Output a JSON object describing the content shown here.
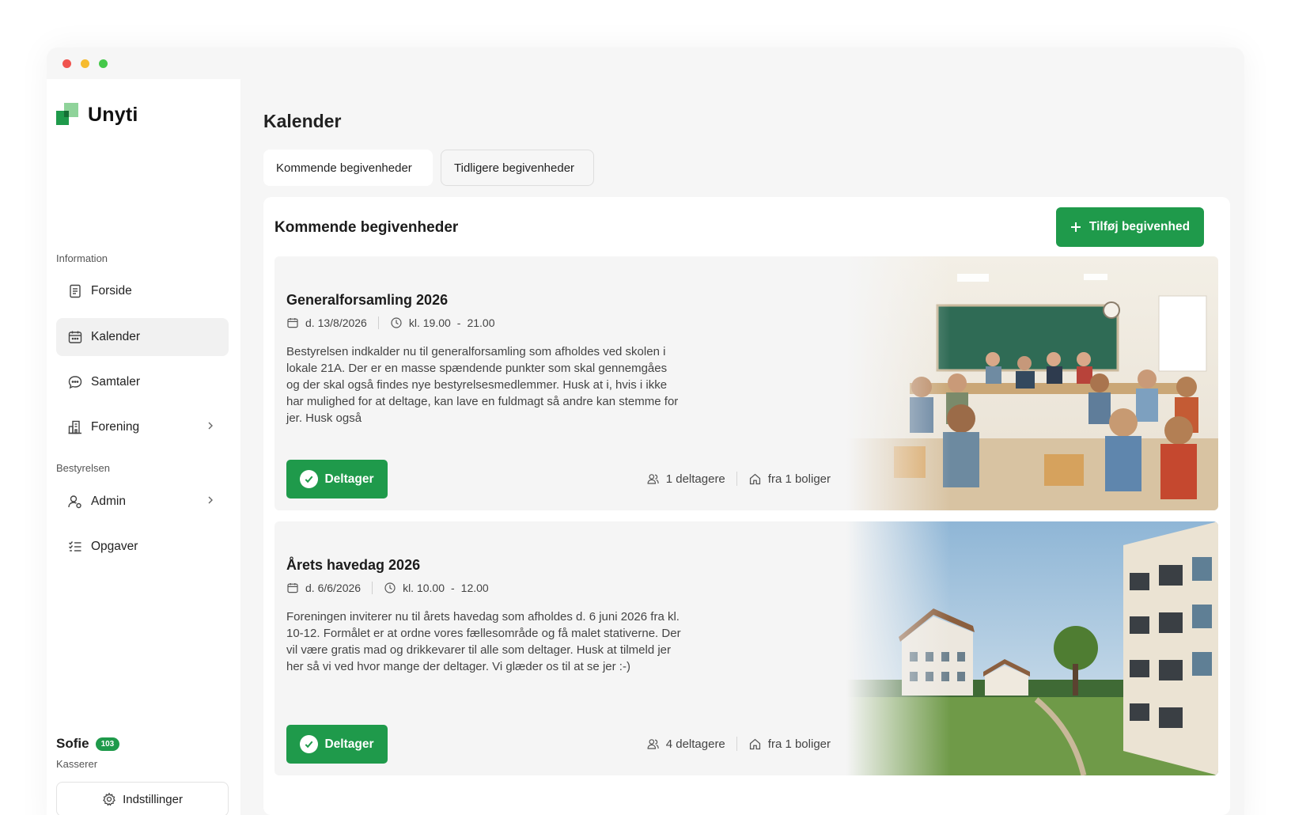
{
  "window": {
    "controls": [
      "close",
      "minimize",
      "maximize"
    ]
  },
  "brand": {
    "name": "Unyti",
    "colors": {
      "green": "#1f9a4b",
      "light_green": "#8fd39a"
    }
  },
  "sidebar": {
    "sections": [
      {
        "label": "Information"
      },
      {
        "label": "Bestyrelsen"
      }
    ],
    "items": [
      {
        "label": "Forside",
        "icon": "document-icon"
      },
      {
        "label": "Kalender",
        "icon": "calendar-icon",
        "active": true
      },
      {
        "label": "Samtaler",
        "icon": "chat-bubble-icon"
      },
      {
        "label": "Forening",
        "icon": "buildings-icon",
        "has_submenu": true
      },
      {
        "label": "Admin",
        "icon": "user-gear-icon",
        "has_submenu": true
      },
      {
        "label": "Opgaver",
        "icon": "checklist-icon"
      }
    ],
    "user": {
      "name": "Sofie",
      "badge": "103",
      "role": "Kasserer"
    },
    "settings_label": "Indstillinger"
  },
  "main": {
    "title": "Kalender",
    "tabs": [
      {
        "label": "Kommende begivenheder",
        "active": true
      },
      {
        "label": "Tidligere begivenheder",
        "active": false
      }
    ],
    "panel_title": "Kommende begivenheder",
    "add_button": "Tilføj begivenhed",
    "events": [
      {
        "title": "Generalforsamling 2026",
        "date": "d. 13/8/2026",
        "time_from": "kl. 19.00",
        "time_to": "21.00",
        "description": "Bestyrelsen indkalder nu til generalforsamling som afholdes ved skolen i lokale 21A. Der er en masse spændende punkter som skal gennemgåes og der skal også findes nye bestyrelsesmedlemmer. Husk at i, hvis i ikke har mulighed for at deltage, kan lave en fuldmagt så andre kan stemme for jer. Husk også",
        "attend_label": "Deltager",
        "participants": "1 deltagere",
        "households": "fra 1 boliger"
      },
      {
        "title": "Årets havedag 2026",
        "date": "d. 6/6/2026",
        "time_from": "kl. 10.00",
        "time_to": "12.00",
        "description": "Foreningen inviterer nu til årets havedag som afholdes d. 6 juni 2026 fra kl. 10-12. Formålet er at ordne vores fællesområde og få malet stativerne. Der vil være gratis mad og drikkevarer til alle som deltager. Husk at tilmeld jer her så vi ved hvor mange der deltager. Vi glæder os til at se jer :-)",
        "attend_label": "Deltager",
        "participants": "4 deltagere",
        "households": "fra 1 boliger"
      }
    ]
  }
}
